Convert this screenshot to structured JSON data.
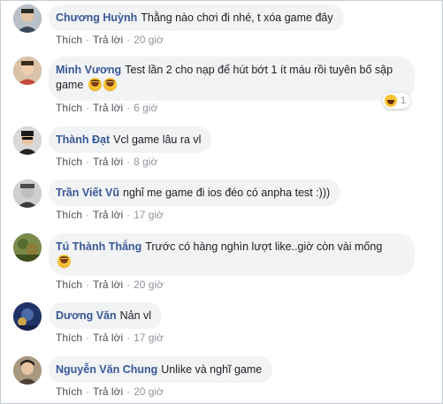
{
  "actions": {
    "like": "Thích",
    "reply": "Trả lời",
    "separator": "·"
  },
  "comments": [
    {
      "author": "Chương Huỳnh",
      "text": "Thằng nào chơi đi nhé, t xóa game đây",
      "time": "20 giờ",
      "avatar_color": "#9aa3ad"
    },
    {
      "author": "Minh Vương",
      "text": "Test lần 2 cho nạp để hút bớt 1 ít máu rồi tuyên bố sập",
      "text2": "game",
      "time": "6 giờ",
      "avatar_color": "#c8a07a",
      "reaction_count": "1"
    },
    {
      "author": "Thành Đạt",
      "text": "Vcl game lâu ra vl",
      "time": "8 giờ",
      "avatar_color": "#3a3a3a"
    },
    {
      "author": "Trần Viết Vũ",
      "text": "nghỉ me game đi ios đéo có anpha test :)))",
      "time": "17 giờ",
      "avatar_color": "#6c6c6c"
    },
    {
      "author": "Tú Thành Thắng",
      "text": "Trước có hàng nghìn lượt like..giờ còn vài mống",
      "time": "20 giờ",
      "avatar_color": "#6a7f3a"
    },
    {
      "author": "Dương Văn",
      "text": "Nản vl",
      "time": "17 giờ",
      "avatar_color": "#2f4f8a"
    },
    {
      "author": "Nguyễn Văn Chung",
      "text": "Unlike và nghĩ game",
      "time": "20 giờ",
      "avatar_color": "#8a7a6a"
    }
  ]
}
